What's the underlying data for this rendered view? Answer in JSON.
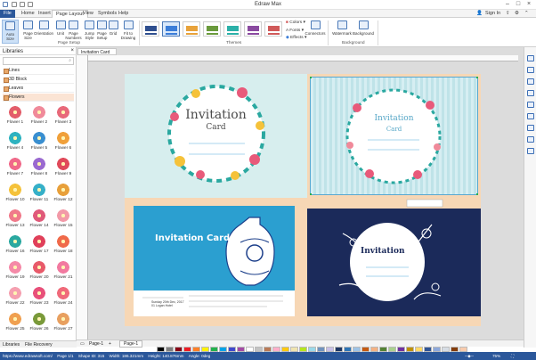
{
  "app": {
    "title": "Edraw Max"
  },
  "menu": {
    "tabs": [
      "File",
      "Home",
      "Insert",
      "Page Layout",
      "View",
      "Symbols",
      "Help"
    ],
    "active": "Page Layout",
    "sign_in": "Sign In"
  },
  "ribbon": {
    "page_setup_buttons": [
      "Auto Size",
      "Page Size",
      "Orientation",
      "Unit",
      "Page Numbers",
      "Jump Style",
      "Page Setup",
      "Grid",
      "Fit to Drawing"
    ],
    "page_setup_group": "Page Setup",
    "themes_group": "Themes",
    "theme_colors": [
      "#2f4f8f",
      "#3b7dd8",
      "#e8a23a",
      "#6a9a3c",
      "#2bb0a8",
      "#8a4aa0",
      "#d05a5a"
    ],
    "colors_label": "Colors",
    "fonts_label": "Fonts",
    "effects_label": "Effects",
    "connectors_label": "Connectors",
    "watermark_label": "Watermark",
    "background_label": "Background",
    "background_group": "Background"
  },
  "libraries": {
    "header": "Libraries",
    "categories": [
      "Lines",
      "3D Block",
      "Leaves",
      "Flowers"
    ],
    "items": [
      {
        "label": "Flower 1",
        "color": "#e35d6a"
      },
      {
        "label": "Flower 2",
        "color": "#f08a9a"
      },
      {
        "label": "Flower 3",
        "color": "#e8697a"
      },
      {
        "label": "Flower 4",
        "color": "#2fb3c0"
      },
      {
        "label": "Flower 5",
        "color": "#3a8fd0"
      },
      {
        "label": "Flower 6",
        "color": "#f0a03a"
      },
      {
        "label": "Flower 7",
        "color": "#f06a8a"
      },
      {
        "label": "Flower 8",
        "color": "#9a6ad0"
      },
      {
        "label": "Flower 9",
        "color": "#e04a5a"
      },
      {
        "label": "Flower 10",
        "color": "#f5c23a"
      },
      {
        "label": "Flower 11",
        "color": "#36b0c8"
      },
      {
        "label": "Flower 12",
        "color": "#e8a03a"
      },
      {
        "label": "Flower 13",
        "color": "#f07a8a"
      },
      {
        "label": "Flower 14",
        "color": "#e05a7a"
      },
      {
        "label": "Flower 15",
        "color": "#f29aa8"
      },
      {
        "label": "Flower 16",
        "color": "#2aa8a0"
      },
      {
        "label": "Flower 17",
        "color": "#e0405a"
      },
      {
        "label": "Flower 18",
        "color": "#f06a4a"
      },
      {
        "label": "Flower 19",
        "color": "#f58aa8"
      },
      {
        "label": "Flower 20",
        "color": "#e85a6a"
      },
      {
        "label": "Flower 21",
        "color": "#f27aa0"
      },
      {
        "label": "Flower 22",
        "color": "#f5a0b0"
      },
      {
        "label": "Flower 23",
        "color": "#e8507a"
      },
      {
        "label": "Flower 24",
        "color": "#f06a7a"
      },
      {
        "label": "Flower 25",
        "color": "#f0a050"
      },
      {
        "label": "Flower 26",
        "color": "#7a9a3a"
      },
      {
        "label": "Flower 27",
        "color": "#e8a060"
      }
    ],
    "bottom_tabs": [
      "Libraries",
      "File Recovery"
    ]
  },
  "document": {
    "tab": "Invitation Card 1"
  },
  "cards": {
    "c1": {
      "title": "Invitation",
      "subtitle": "Card"
    },
    "c2": {
      "title": "Invitation",
      "subtitle": "Card"
    },
    "c3": {
      "title": "Invitation Card",
      "details": "Sunday 20th Dec, 2017\n01 Logan Hotel"
    },
    "c4": {
      "title": "Invitation"
    }
  },
  "pagebar": {
    "page_label": "Page-1",
    "tab": "Page-1",
    "add": "+"
  },
  "status": {
    "url": "https://www.edrawsoft.com/",
    "page": "Page 1/1",
    "shape_id": "Shape ID: 315",
    "width": "Width: 186.321mm",
    "height": "Height: 140.876mm",
    "angle": "Angle: 0deg",
    "zoom": "75%"
  },
  "palette": [
    "#000000",
    "#7f7f7f",
    "#880015",
    "#ed1c24",
    "#ff7f27",
    "#fff200",
    "#22b14c",
    "#00a2e8",
    "#3f48cc",
    "#a349a4",
    "#ffffff",
    "#c3c3c3",
    "#b97a57",
    "#ffaec9",
    "#ffc90e",
    "#efe4b0",
    "#b5e61d",
    "#99d9ea",
    "#7092be",
    "#c8bfe7",
    "#1f3864",
    "#2e75b6",
    "#9dc3e6",
    "#c55a11",
    "#f4b183",
    "#548235",
    "#a9d18e",
    "#7030a0",
    "#bf9000",
    "#ffd966",
    "#305496",
    "#8ea9db",
    "#d6dce4",
    "#833c0c",
    "#f8cbad"
  ]
}
